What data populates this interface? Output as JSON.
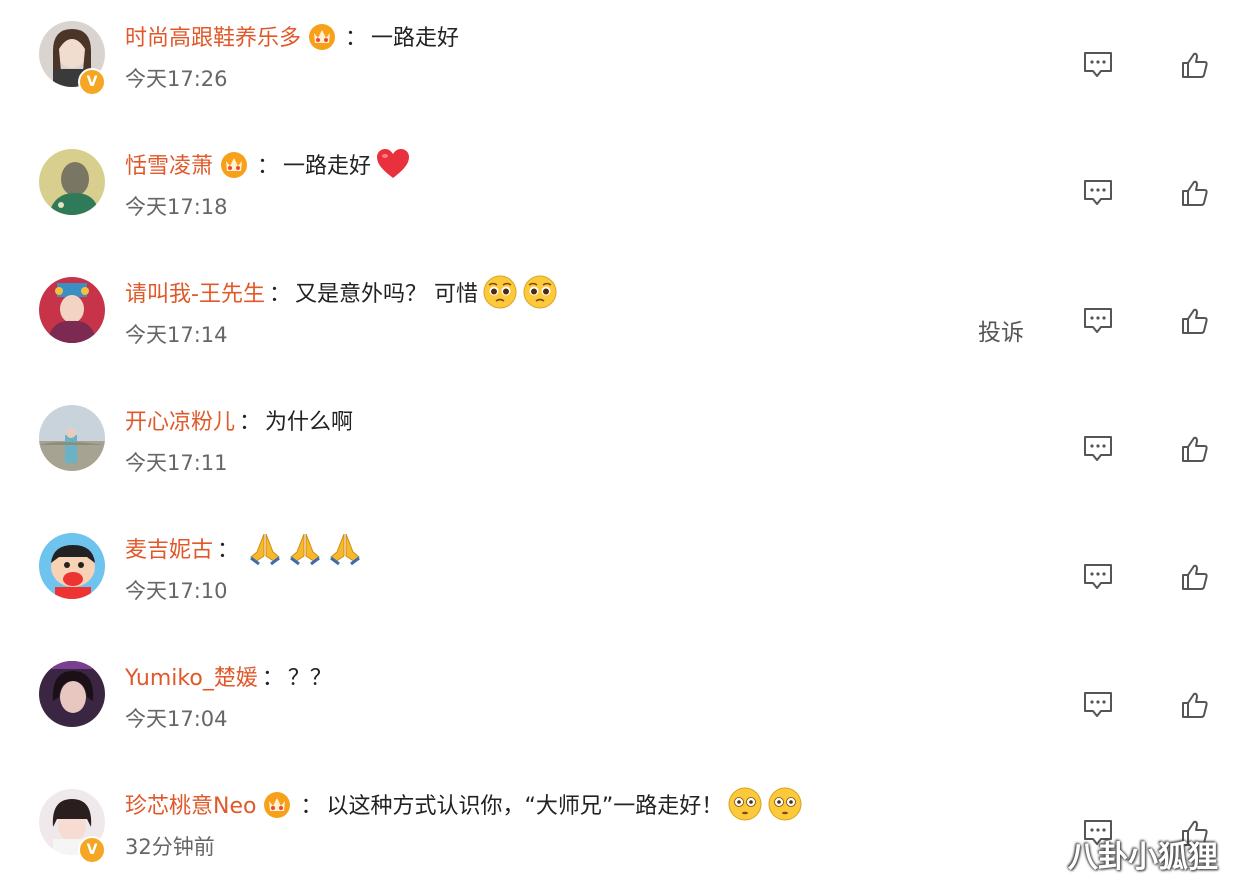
{
  "comments": [
    {
      "username": "时尚高跟鞋养乐多",
      "has_badge": true,
      "separator": "：",
      "text": "一路走好",
      "emojis": [],
      "time": "今天17:26",
      "verified": true,
      "avatar": "avatar-woman-dark-hair"
    },
    {
      "username": "恬雪凌萧",
      "has_badge": true,
      "separator": "：",
      "text": "一路走好",
      "emojis": [
        "red-heart"
      ],
      "time": "今天17:18",
      "verified": false,
      "avatar": "avatar-green-portrait"
    },
    {
      "username": "请叫我-王先生",
      "has_badge": false,
      "separator": "：",
      "text": "又是意外吗？ 可惜",
      "emojis": [
        "pleading-face",
        "pleading-face"
      ],
      "time": "今天17:14",
      "verified": false,
      "report": "投诉",
      "avatar": "avatar-costume"
    },
    {
      "username": "开心凉粉儿",
      "has_badge": false,
      "separator": "：",
      "text": "为什么啊",
      "emojis": [],
      "time": "今天17:11",
      "verified": false,
      "avatar": "avatar-outdoor"
    },
    {
      "username": "麦吉妮古",
      "has_badge": false,
      "separator": "：",
      "text": "",
      "emojis": [
        "folded-hands",
        "folded-hands",
        "folded-hands"
      ],
      "time": "今天17:10",
      "verified": false,
      "avatar": "avatar-cartoon-boy"
    },
    {
      "username": "Yumiko_楚媛",
      "has_badge": false,
      "separator": "：",
      "text": "？？",
      "emojis": [],
      "time": "今天17:04",
      "verified": false,
      "avatar": "avatar-woman-purple"
    },
    {
      "username": "珍芯桃意Neo",
      "has_badge": true,
      "separator": "：",
      "text": "以这种方式认识你，“大师兄”一路走好！",
      "emojis": [
        "flushed-face",
        "flushed-face"
      ],
      "time": "32分钟前",
      "verified": true,
      "avatar": "avatar-woman-bangs"
    }
  ],
  "icons": {
    "reply": "comment-icon",
    "like": "thumbs-up-icon",
    "verified": "v-badge",
    "vip": "crown-badge"
  },
  "colors": {
    "username": "#e0592a",
    "time": "#666666",
    "badge": "#f5a623"
  },
  "watermark": "八卦小狐狸"
}
